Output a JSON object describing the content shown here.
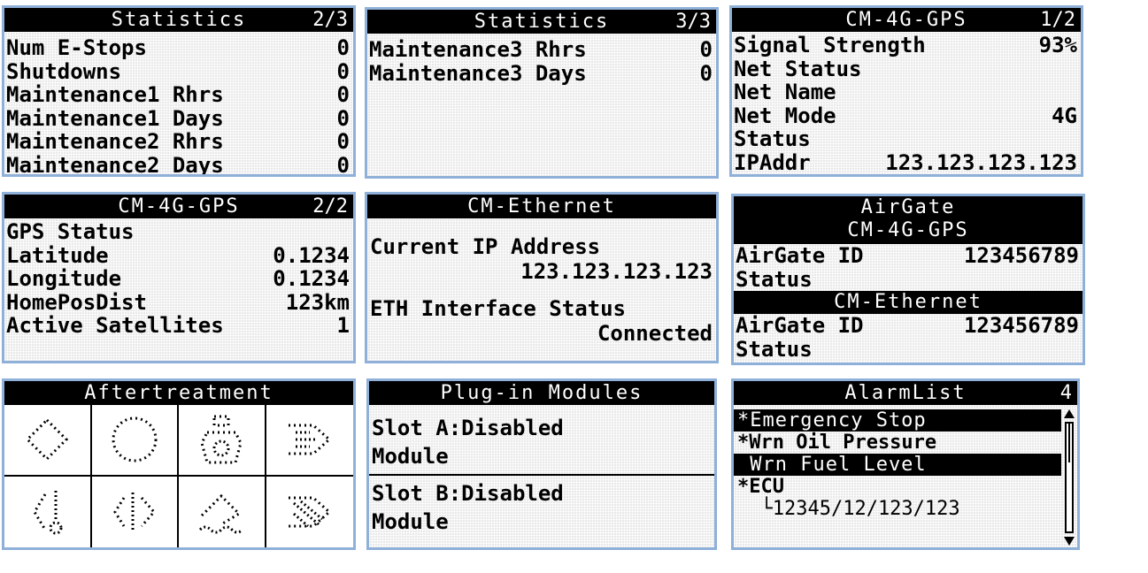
{
  "statistics2": {
    "title": "Statistics",
    "page": "2/3",
    "rows": [
      {
        "label": "Num E-Stops",
        "value": "0"
      },
      {
        "label": "Shutdowns",
        "value": "0"
      },
      {
        "label": "Maintenance1 Rhrs",
        "value": "0"
      },
      {
        "label": "Maintenance1 Days",
        "value": "0"
      },
      {
        "label": "Maintenance2 Rhrs",
        "value": "0"
      },
      {
        "label": "Maintenance2 Days",
        "value": "0"
      }
    ]
  },
  "statistics3": {
    "title": "Statistics",
    "page": "3/3",
    "rows": [
      {
        "label": "Maintenance3 Rhrs",
        "value": "0"
      },
      {
        "label": "Maintenance3 Days",
        "value": "0"
      }
    ]
  },
  "gps1": {
    "title": "CM-4G-GPS",
    "page": "1/2",
    "rows": [
      {
        "label": "Signal Strength",
        "value": "93%"
      },
      {
        "label": "Net Status",
        "value": ""
      },
      {
        "label": "Net Name",
        "value": ""
      },
      {
        "label": "Net Mode",
        "value": "4G"
      },
      {
        "label": "Status",
        "value": ""
      },
      {
        "label": "IPAddr",
        "value": "123.123.123.123"
      }
    ]
  },
  "gps2": {
    "title": "CM-4G-GPS",
    "page": "2/2",
    "rows": [
      {
        "label": "GPS Status",
        "value": ""
      },
      {
        "label": "Latitude",
        "value": "0.1234"
      },
      {
        "label": "Longitude",
        "value": "0.1234"
      },
      {
        "label": "HomePosDist",
        "value": "123km"
      },
      {
        "label": "Active Satellites",
        "value": "1"
      }
    ]
  },
  "ethernet": {
    "title": "CM-Ethernet",
    "ip_label": "Current IP Address",
    "ip_value": "123.123.123.123",
    "iface_label": "ETH Interface Status",
    "iface_value": "Connected"
  },
  "airgate": {
    "title": "AirGate",
    "subtitle": "CM-4G-GPS",
    "id_label": "AirGate ID",
    "id_value": "123456789",
    "status_label": "Status",
    "eth_title": "CM-Ethernet",
    "eth_id_label": "AirGate ID",
    "eth_id_value": "123456789",
    "eth_status_label": "Status"
  },
  "aftertreatment": {
    "title": "Aftertreatment",
    "icons": [
      "diamond-indicator-icon",
      "circle-indicator-icon",
      "fuel-gauge-icon",
      "exhaust-flow-icon",
      "temperature-icon",
      "regeneration-icon",
      "wave-level-icon",
      "filter-icon"
    ]
  },
  "plugin": {
    "title": "Plug-in Modules",
    "slot_a": "Slot A:Disabled",
    "slot_a_sub": "Module",
    "slot_b": "Slot B:Disabled",
    "slot_b_sub": "Module"
  },
  "alarmlist": {
    "title": "AlarmList",
    "count": "4",
    "items": [
      {
        "text": "*Emergency Stop",
        "inverted": true
      },
      {
        "text": "*Wrn Oil Pressure",
        "inverted": false
      },
      {
        "text": " Wrn Fuel Level",
        "inverted": true
      },
      {
        "text": "*ECU",
        "inverted": false
      },
      {
        "text": "  └12345/12/123/123",
        "inverted": false
      }
    ]
  }
}
